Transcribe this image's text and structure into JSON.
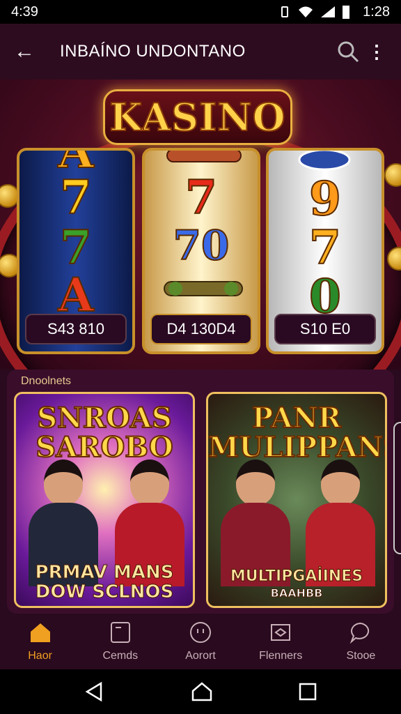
{
  "status_bar": {
    "time": "4:39",
    "clock": "1:28"
  },
  "app_bar": {
    "title": "INBAÍNO UNDONTANO"
  },
  "hero": {
    "logo": "KASINO",
    "reels": [
      {
        "symbols": [
          "A",
          "7",
          "7",
          "A"
        ],
        "amount": "S43 810"
      },
      {
        "symbols": [
          "7",
          "70"
        ],
        "amount": "D4 130D4"
      },
      {
        "symbols": [
          "9",
          "7",
          "0"
        ],
        "amount": "S10 E0"
      }
    ]
  },
  "section": {
    "label": "Dnoolnets",
    "cards": [
      {
        "title": "SNROAS SAROBO",
        "caption": "PRMAV MANS DOW SCLNOS"
      },
      {
        "title": "PANR MULIPPANS",
        "caption": "MULTIPGAİINES",
        "sub": "BAAHBB"
      }
    ]
  },
  "bottom_nav": [
    {
      "label": "Haor",
      "icon": "home-icon",
      "active": true
    },
    {
      "label": "Cemds",
      "icon": "cards-icon",
      "active": false
    },
    {
      "label": "Aorort",
      "icon": "chip-icon",
      "active": false
    },
    {
      "label": "Flenners",
      "icon": "tickets-icon",
      "active": false
    },
    {
      "label": "Stooe",
      "icon": "chat-icon",
      "active": false
    }
  ],
  "colors": {
    "accent": "#f0a020",
    "background": "#2a0a1e",
    "gold": "#ffd24a"
  }
}
